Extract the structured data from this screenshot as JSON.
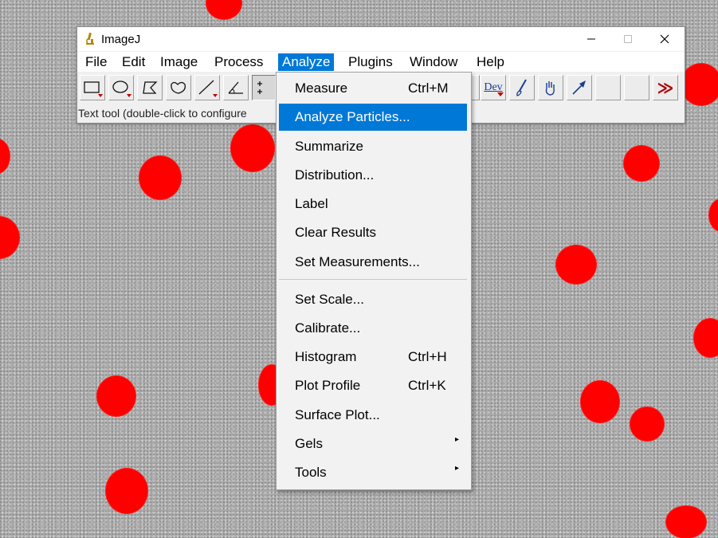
{
  "window": {
    "title": "ImageJ",
    "minimize": "—",
    "maximize": "☐",
    "close": "✕"
  },
  "menubar": [
    "File",
    "Edit",
    "Image",
    "Process",
    "Analyze",
    "Plugins",
    "Window",
    "Help"
  ],
  "active_menu": "Analyze",
  "toolbar": {
    "tools": [
      "rectangle-tool",
      "oval-tool",
      "polygon-tool",
      "freehand-tool",
      "line-tool",
      "angle-tool",
      "point-tool",
      "dev-tool",
      "brush-tool",
      "pick-tool",
      "arrow-tool",
      "empty-slot",
      "empty-slot",
      "more-tools"
    ],
    "dev_label": "Dev",
    "more_label": "≫",
    "status_text": "Text tool (double-click to configure"
  },
  "analyze_menu": {
    "items": [
      {
        "label": "Measure",
        "shortcut": "Ctrl+M"
      },
      {
        "label": "Analyze Particles...",
        "shortcut": "",
        "highlighted": true
      },
      {
        "label": "Summarize",
        "shortcut": ""
      },
      {
        "label": "Distribution...",
        "shortcut": ""
      },
      {
        "label": "Label",
        "shortcut": ""
      },
      {
        "label": "Clear Results",
        "shortcut": ""
      },
      {
        "label": "Set Measurements...",
        "shortcut": ""
      },
      {
        "label": "Set Scale...",
        "shortcut": ""
      },
      {
        "label": "Calibrate...",
        "shortcut": ""
      },
      {
        "label": "Histogram",
        "shortcut": "Ctrl+H"
      },
      {
        "label": "Plot Profile",
        "shortcut": "Ctrl+K"
      },
      {
        "label": "Surface Plot...",
        "shortcut": ""
      },
      {
        "label": "Gels",
        "shortcut": "",
        "submenu": true
      },
      {
        "label": "Tools",
        "shortcut": "",
        "submenu": true
      }
    ],
    "submenu_arrow": "▸"
  },
  "colors": {
    "highlight": "#0078d7",
    "particle": "#ff0000",
    "background": "#a9a9a9"
  }
}
